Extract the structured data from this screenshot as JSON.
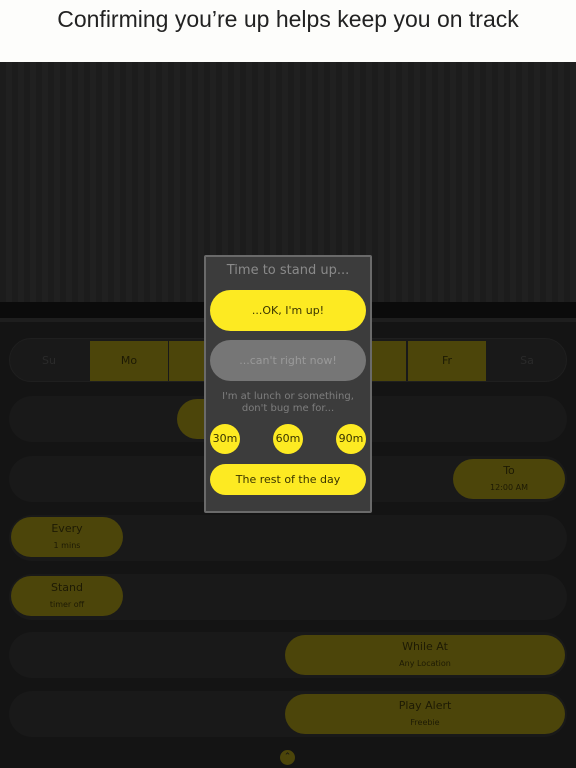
{
  "header": {
    "title": "Confirming you’re up helps keep you on track"
  },
  "days": [
    {
      "label": "Su",
      "on": false
    },
    {
      "label": "Mo",
      "on": true
    },
    {
      "label": "Fr",
      "on": true
    },
    {
      "label": "Sa",
      "on": false
    }
  ],
  "rows": {
    "to": {
      "label": "To",
      "value": "12:00 AM"
    },
    "every": {
      "label": "Every",
      "value": "1 mins"
    },
    "stand": {
      "label": "Stand",
      "value": "timer off"
    },
    "while_at": {
      "label": "While At",
      "value": "Any Location"
    },
    "play_alert": {
      "label": "Play Alert",
      "value": "Freebie"
    }
  },
  "dialog": {
    "title": "Time to stand up...",
    "ok": "...OK, I'm up!",
    "cant": "...can't right now!",
    "message": "I'm at lunch or something, don't bug me for...",
    "snooze": [
      "30m",
      "60m",
      "90m"
    ],
    "rest": "The rest of the day"
  },
  "colors": {
    "accent": "#fdea22",
    "dimmed_accent": "#4c450a"
  },
  "icons": {
    "scroll_up": "chevron-up-icon"
  }
}
